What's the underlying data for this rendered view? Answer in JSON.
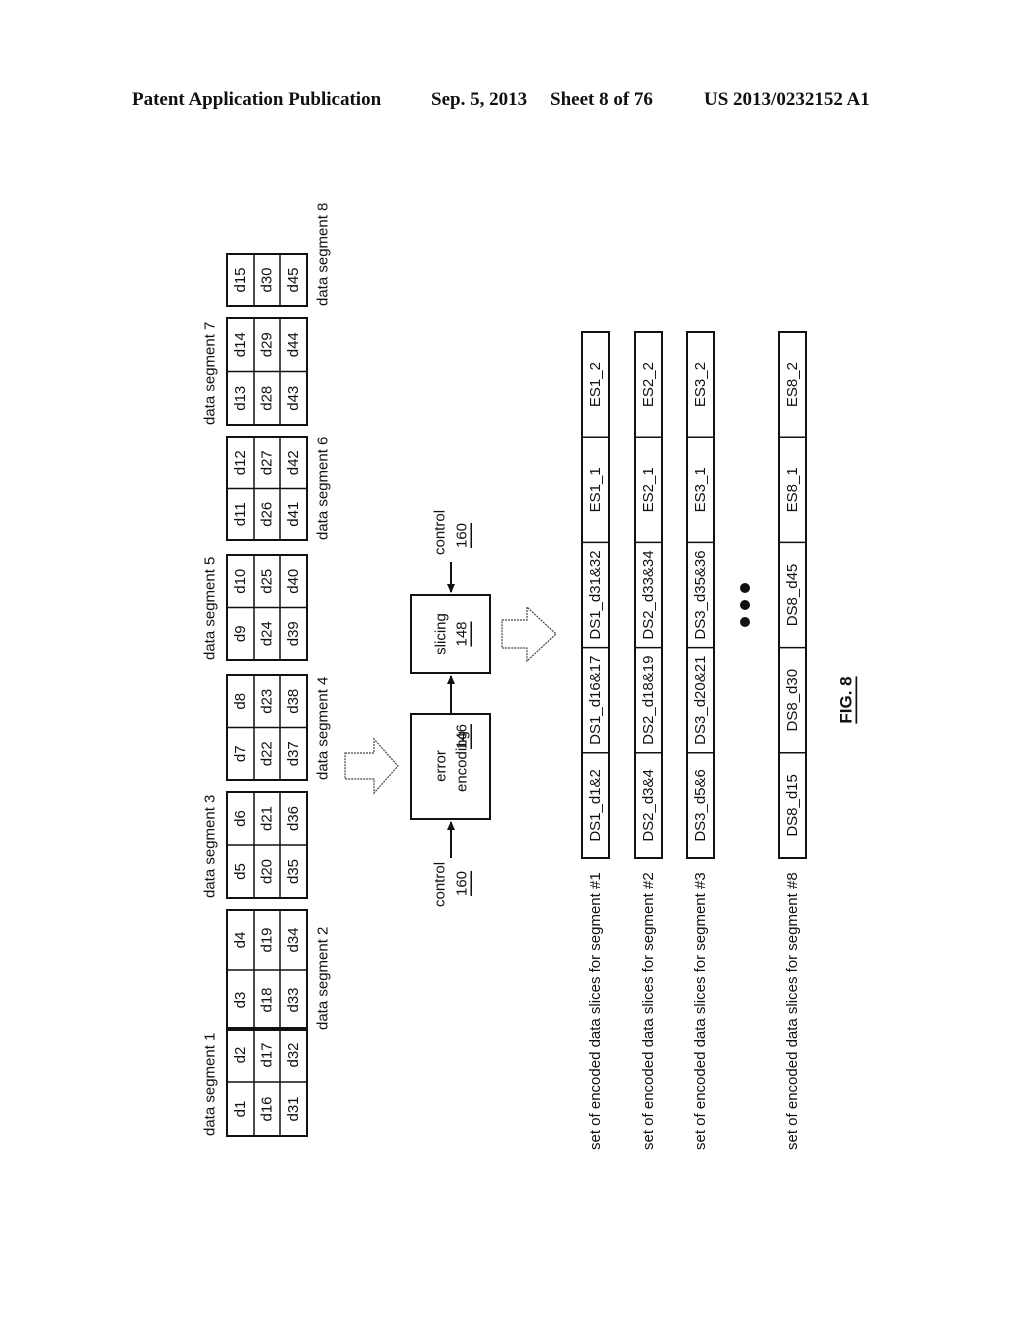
{
  "header": {
    "left": "Patent Application Publication",
    "date": "Sep. 5, 2013",
    "sheet": "Sheet 8 of 76",
    "pubno": "US 2013/0232152 A1"
  },
  "figure_label": "FIG. 8",
  "data_segments": [
    {
      "label": "data segment 1",
      "columns": [
        [
          "d1",
          "d16",
          "d31"
        ],
        [
          "d2",
          "d17",
          "d32"
        ]
      ]
    },
    {
      "label": "data segment 2",
      "columns": [
        [
          "d3",
          "d18",
          "d33"
        ],
        [
          "d4",
          "d19",
          "d34"
        ]
      ]
    },
    {
      "label": "data segment 3",
      "columns": [
        [
          "d5",
          "d20",
          "d35"
        ],
        [
          "d6",
          "d21",
          "d36"
        ]
      ]
    },
    {
      "label": "data segment 4",
      "columns": [
        [
          "d7",
          "d22",
          "d37"
        ],
        [
          "d8",
          "d23",
          "d38"
        ]
      ]
    },
    {
      "label": "data segment 5",
      "columns": [
        [
          "d9",
          "d24",
          "d39"
        ],
        [
          "d10",
          "d25",
          "d40"
        ]
      ]
    },
    {
      "label": "data segment 6",
      "columns": [
        [
          "d11",
          "d26",
          "d41"
        ],
        [
          "d12",
          "d27",
          "d42"
        ]
      ]
    },
    {
      "label": "data segment 7",
      "columns": [
        [
          "d13",
          "d28",
          "d43"
        ],
        [
          "d14",
          "d29",
          "d44"
        ]
      ]
    },
    {
      "label": "data segment 8",
      "columns": [
        [
          "d15",
          "d30",
          "d45"
        ]
      ]
    }
  ],
  "blocks": {
    "error_encoding": {
      "line1": "error",
      "line2": "encoding",
      "ref": "146"
    },
    "slicing": {
      "line1": "slicing",
      "ref": "148"
    },
    "control": {
      "label": "control",
      "ref": "160"
    }
  },
  "encoded_sets": [
    {
      "label": "set of encoded data slices for segment #1",
      "slices": [
        "DS1_d1&2",
        "DS1_d16&17",
        "DS1_d31&32",
        "ES1_1",
        "ES1_2"
      ]
    },
    {
      "label": "set of encoded data slices for segment #2",
      "slices": [
        "DS2_d3&4",
        "DS2_d18&19",
        "DS2_d33&34",
        "ES2_1",
        "ES2_2"
      ]
    },
    {
      "label": "set of encoded data slices for segment #3",
      "slices": [
        "DS3_d5&6",
        "DS3_d20&21",
        "DS3_d35&36",
        "ES3_1",
        "ES3_2"
      ]
    },
    {
      "label": "set of encoded data slices for segment #8",
      "slices": [
        "DS8_d15",
        "DS8_d30",
        "DS8_d45",
        "ES8_1",
        "ES8_2"
      ]
    }
  ]
}
